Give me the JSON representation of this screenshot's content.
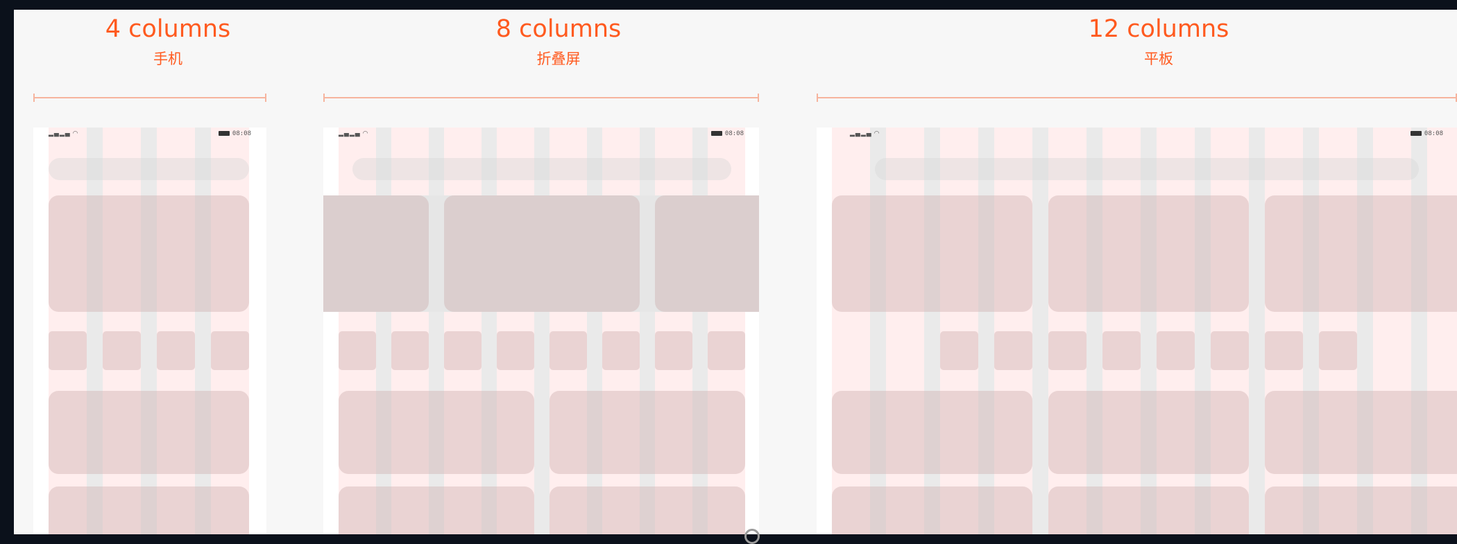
{
  "sections": [
    {
      "title": "4 columns",
      "subtitle": "手机",
      "status_time": "08:08",
      "column_count": 4
    },
    {
      "title": "8 columns",
      "subtitle": "折叠屏",
      "status_time": "08:08",
      "column_count": 8
    },
    {
      "title": "12 columns",
      "subtitle": "平板",
      "status_time": "08:08",
      "column_count": 12
    }
  ],
  "colors": {
    "accent": "#ff5a1f",
    "ruler": "#f6b49e",
    "column": "#ffe8e8",
    "gutter": "#e6e6e6",
    "block": "#e8d4d4",
    "background": "#f7f7f7",
    "frame": "#0b111b"
  },
  "icons": {
    "signal": "signal-icon",
    "wifi": "wifi-icon",
    "battery": "battery-icon"
  }
}
